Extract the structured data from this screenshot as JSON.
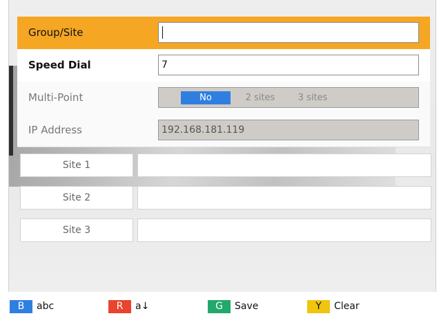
{
  "form": {
    "group_site": {
      "label": "Group/Site",
      "value": ""
    },
    "speed_dial": {
      "label": "Speed Dial",
      "value": "7"
    },
    "multi_point": {
      "label": "Multi-Point",
      "options": [
        "No",
        "2 sites",
        "3 sites"
      ],
      "selected": "No"
    },
    "ip_address": {
      "label": "IP Address",
      "value": "192.168.181.119"
    }
  },
  "sites": [
    {
      "label": "Site 1",
      "value": ""
    },
    {
      "label": "Site 2",
      "value": ""
    },
    {
      "label": "Site 3",
      "value": ""
    }
  ],
  "keys": [
    {
      "chip": "B",
      "label": "abc",
      "color": "#2f7fe0",
      "text_color": "#ffffff"
    },
    {
      "chip": "R",
      "label": "a↓",
      "color": "#e8442e",
      "text_color": "#ffffff"
    },
    {
      "chip": "G",
      "label": "Save",
      "color": "#22a86a",
      "text_color": "#ffffff"
    },
    {
      "chip": "Y",
      "label": "Clear",
      "color": "#f1c40f",
      "text_color": "#111111"
    }
  ],
  "colors": {
    "highlight": "#f5a623",
    "selected_option": "#2f7fe0"
  }
}
